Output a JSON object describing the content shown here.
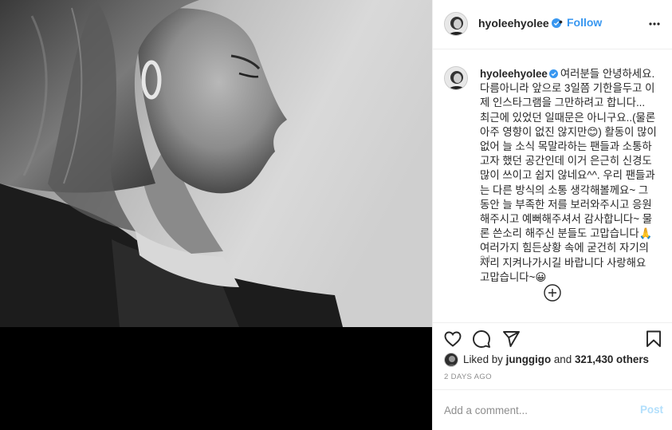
{
  "post": {
    "username": "hyoleehyolee",
    "verified": true,
    "follow_separator": "•",
    "follow_label": "Follow",
    "more_icon": "more-horizontal-icon"
  },
  "caption": {
    "username": "hyoleehyolee",
    "text": "여러분들 안녕하세요. 다름아니라 앞으로 3일쯤 기한을두고 이제 인스타그램을 그만하려고 합니다... 최근에 있었던 일때문은 아니구요..(물론 아주 영향이 없진 않지만😊) 활동이 많이 없어 늘 소식 목말라하는 팬들과 소통하고자 했던 공간인데 이거 은근히 신경도 많이 쓰이고 쉽지 않네요^^. 우리 팬들과는 다른 방식의 소통 생각해볼께요~ 그동안 늘 부족한 저를 보러와주시고 응원해주시고 예뻐해주셔서 감사합니다~ 물론 쓴소리 해주신 분들도 고맙습니다🙏여러가지 힘든상황 속에 굳건히 자기의 자리 지켜나가시길 바랍니다 사랑해요 고맙습니다~😀",
    "time": "2d"
  },
  "actions": {
    "like_icon": "heart-icon",
    "comment_icon": "comment-icon",
    "share_icon": "share-icon",
    "save_icon": "bookmark-icon",
    "load_more_icon": "plus-circle-icon"
  },
  "likes": {
    "prefix": "Liked by ",
    "user": "junggigo",
    "middle": " and ",
    "count": "321,430 others"
  },
  "timestamp": "2 DAYS AGO",
  "comment_box": {
    "placeholder": "Add a comment...",
    "post_label": "Post"
  },
  "colors": {
    "link_blue": "#3897f0",
    "post_disabled": "#b2dffc",
    "muted_text": "#8e8e8e",
    "text": "#262626",
    "border": "#efefef"
  }
}
